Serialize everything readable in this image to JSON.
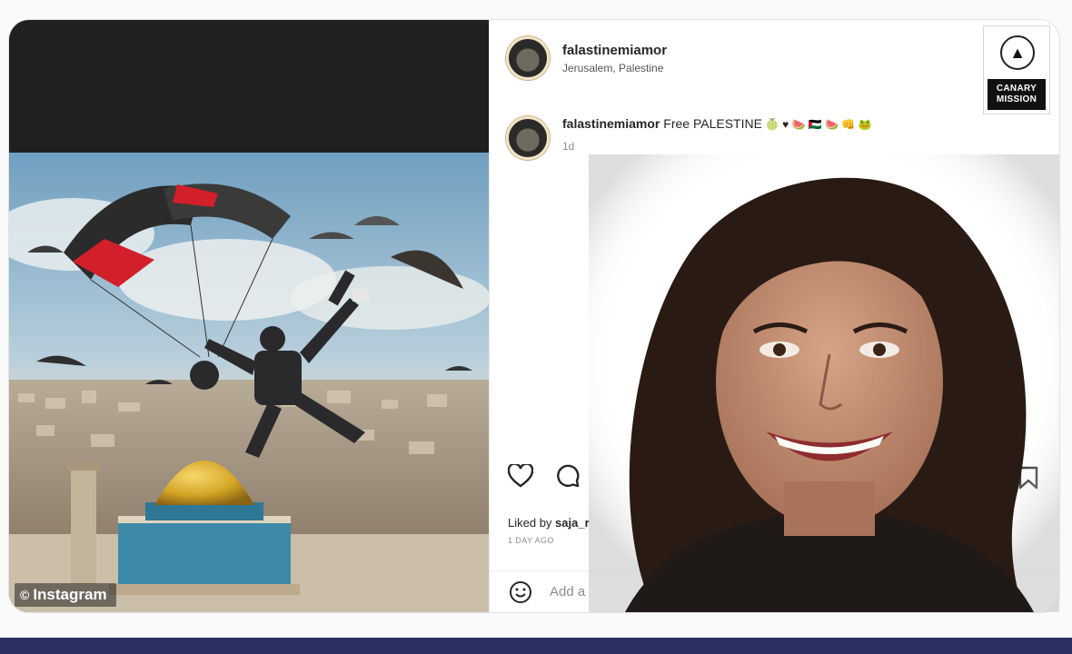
{
  "post": {
    "username": "falastinemiamor",
    "location": "Jerusalem, Palestine",
    "caption_user": "falastinemiamor",
    "caption_text": "Free PALESTINE",
    "caption_emojis": "🍈 ♥ 🍉 🇵🇸 🍉 👊 🐸",
    "time_ago": "1d",
    "liked_by_prefix": "Liked by",
    "liked_by_user": "saja_r",
    "day_ago_label": "1 DAY AGO",
    "comment_placeholder": "Add a"
  },
  "watermark": {
    "icon": "instagram-icon",
    "text": "Instagram"
  },
  "canary": {
    "line1": "CANARY",
    "line2": "MISSION"
  },
  "icons": {
    "like": "heart-icon",
    "comment": "comment-icon",
    "save": "bookmark-icon",
    "emoji": "smiley-icon"
  },
  "colors": {
    "accent_bar": "#2b2f62",
    "canary_label_bg": "#111111",
    "parachute_red": "#d21f2a"
  }
}
